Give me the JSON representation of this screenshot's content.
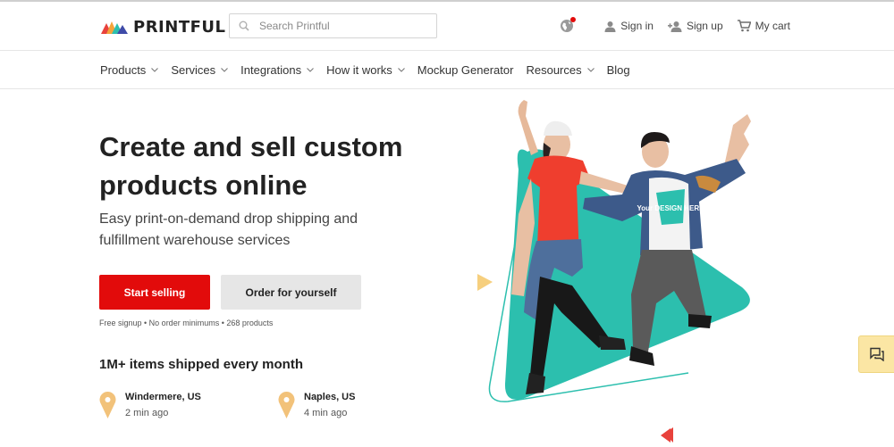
{
  "brand": {
    "name": "PRINTFUL"
  },
  "search": {
    "placeholder": "Search Printful"
  },
  "header": {
    "sign_in": "Sign in",
    "sign_up": "Sign up",
    "cart": "My cart"
  },
  "nav": {
    "items": [
      {
        "label": "Products",
        "has_dropdown": true
      },
      {
        "label": "Services",
        "has_dropdown": true
      },
      {
        "label": "Integrations",
        "has_dropdown": true
      },
      {
        "label": "How it works",
        "has_dropdown": true
      },
      {
        "label": "Mockup Generator",
        "has_dropdown": false
      },
      {
        "label": "Resources",
        "has_dropdown": true
      },
      {
        "label": "Blog",
        "has_dropdown": false
      }
    ]
  },
  "hero": {
    "title_line1": "Create and sell custom",
    "title_line2": "products online",
    "subtitle_line1": "Easy print-on-demand drop shipping and",
    "subtitle_line2": "fulfillment warehouse services",
    "primary_cta": "Start selling",
    "secondary_cta": "Order for yourself",
    "fineprint": "Free signup • No order minimums • 268 products",
    "shirt_text": "Your DESIGN HERE"
  },
  "shipments": {
    "title": "1M+ items shipped every month",
    "locations": [
      {
        "city": "Windermere, US",
        "ago": "2 min ago"
      },
      {
        "city": "Naples, US",
        "ago": "4 min ago"
      }
    ]
  },
  "colors": {
    "accent": "#e20b0b",
    "teal": "#2cbfae",
    "pin": "#f2c27a",
    "chat_bg": "#fbe6a4"
  }
}
